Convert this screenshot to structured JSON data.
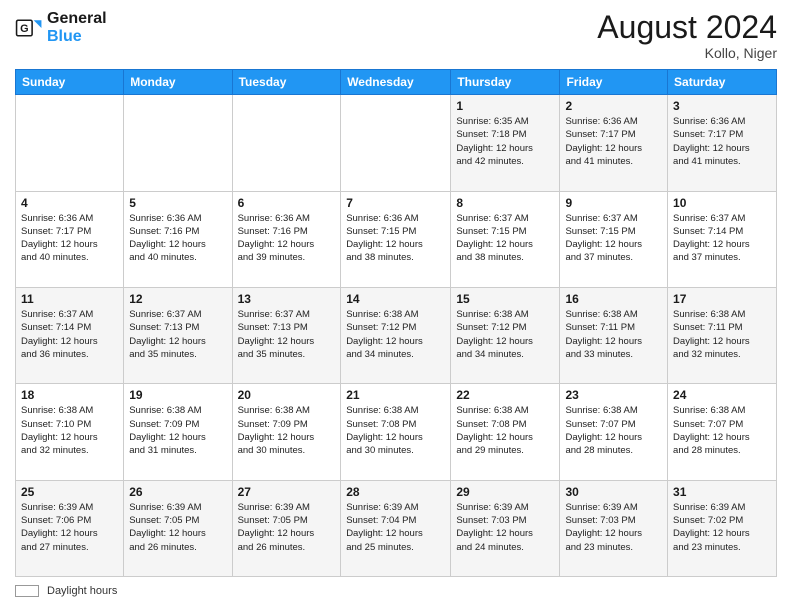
{
  "header": {
    "logo_general": "General",
    "logo_blue": "Blue",
    "month_year": "August 2024",
    "location": "Kollo, Niger"
  },
  "weekdays": [
    "Sunday",
    "Monday",
    "Tuesday",
    "Wednesday",
    "Thursday",
    "Friday",
    "Saturday"
  ],
  "weeks": [
    [
      {
        "day": "",
        "detail": ""
      },
      {
        "day": "",
        "detail": ""
      },
      {
        "day": "",
        "detail": ""
      },
      {
        "day": "",
        "detail": ""
      },
      {
        "day": "1",
        "detail": "Sunrise: 6:35 AM\nSunset: 7:18 PM\nDaylight: 12 hours\nand 42 minutes."
      },
      {
        "day": "2",
        "detail": "Sunrise: 6:36 AM\nSunset: 7:17 PM\nDaylight: 12 hours\nand 41 minutes."
      },
      {
        "day": "3",
        "detail": "Sunrise: 6:36 AM\nSunset: 7:17 PM\nDaylight: 12 hours\nand 41 minutes."
      }
    ],
    [
      {
        "day": "4",
        "detail": "Sunrise: 6:36 AM\nSunset: 7:17 PM\nDaylight: 12 hours\nand 40 minutes."
      },
      {
        "day": "5",
        "detail": "Sunrise: 6:36 AM\nSunset: 7:16 PM\nDaylight: 12 hours\nand 40 minutes."
      },
      {
        "day": "6",
        "detail": "Sunrise: 6:36 AM\nSunset: 7:16 PM\nDaylight: 12 hours\nand 39 minutes."
      },
      {
        "day": "7",
        "detail": "Sunrise: 6:36 AM\nSunset: 7:15 PM\nDaylight: 12 hours\nand 38 minutes."
      },
      {
        "day": "8",
        "detail": "Sunrise: 6:37 AM\nSunset: 7:15 PM\nDaylight: 12 hours\nand 38 minutes."
      },
      {
        "day": "9",
        "detail": "Sunrise: 6:37 AM\nSunset: 7:15 PM\nDaylight: 12 hours\nand 37 minutes."
      },
      {
        "day": "10",
        "detail": "Sunrise: 6:37 AM\nSunset: 7:14 PM\nDaylight: 12 hours\nand 37 minutes."
      }
    ],
    [
      {
        "day": "11",
        "detail": "Sunrise: 6:37 AM\nSunset: 7:14 PM\nDaylight: 12 hours\nand 36 minutes."
      },
      {
        "day": "12",
        "detail": "Sunrise: 6:37 AM\nSunset: 7:13 PM\nDaylight: 12 hours\nand 35 minutes."
      },
      {
        "day": "13",
        "detail": "Sunrise: 6:37 AM\nSunset: 7:13 PM\nDaylight: 12 hours\nand 35 minutes."
      },
      {
        "day": "14",
        "detail": "Sunrise: 6:38 AM\nSunset: 7:12 PM\nDaylight: 12 hours\nand 34 minutes."
      },
      {
        "day": "15",
        "detail": "Sunrise: 6:38 AM\nSunset: 7:12 PM\nDaylight: 12 hours\nand 34 minutes."
      },
      {
        "day": "16",
        "detail": "Sunrise: 6:38 AM\nSunset: 7:11 PM\nDaylight: 12 hours\nand 33 minutes."
      },
      {
        "day": "17",
        "detail": "Sunrise: 6:38 AM\nSunset: 7:11 PM\nDaylight: 12 hours\nand 32 minutes."
      }
    ],
    [
      {
        "day": "18",
        "detail": "Sunrise: 6:38 AM\nSunset: 7:10 PM\nDaylight: 12 hours\nand 32 minutes."
      },
      {
        "day": "19",
        "detail": "Sunrise: 6:38 AM\nSunset: 7:09 PM\nDaylight: 12 hours\nand 31 minutes."
      },
      {
        "day": "20",
        "detail": "Sunrise: 6:38 AM\nSunset: 7:09 PM\nDaylight: 12 hours\nand 30 minutes."
      },
      {
        "day": "21",
        "detail": "Sunrise: 6:38 AM\nSunset: 7:08 PM\nDaylight: 12 hours\nand 30 minutes."
      },
      {
        "day": "22",
        "detail": "Sunrise: 6:38 AM\nSunset: 7:08 PM\nDaylight: 12 hours\nand 29 minutes."
      },
      {
        "day": "23",
        "detail": "Sunrise: 6:38 AM\nSunset: 7:07 PM\nDaylight: 12 hours\nand 28 minutes."
      },
      {
        "day": "24",
        "detail": "Sunrise: 6:38 AM\nSunset: 7:07 PM\nDaylight: 12 hours\nand 28 minutes."
      }
    ],
    [
      {
        "day": "25",
        "detail": "Sunrise: 6:39 AM\nSunset: 7:06 PM\nDaylight: 12 hours\nand 27 minutes."
      },
      {
        "day": "26",
        "detail": "Sunrise: 6:39 AM\nSunset: 7:05 PM\nDaylight: 12 hours\nand 26 minutes."
      },
      {
        "day": "27",
        "detail": "Sunrise: 6:39 AM\nSunset: 7:05 PM\nDaylight: 12 hours\nand 26 minutes."
      },
      {
        "day": "28",
        "detail": "Sunrise: 6:39 AM\nSunset: 7:04 PM\nDaylight: 12 hours\nand 25 minutes."
      },
      {
        "day": "29",
        "detail": "Sunrise: 6:39 AM\nSunset: 7:03 PM\nDaylight: 12 hours\nand 24 minutes."
      },
      {
        "day": "30",
        "detail": "Sunrise: 6:39 AM\nSunset: 7:03 PM\nDaylight: 12 hours\nand 23 minutes."
      },
      {
        "day": "31",
        "detail": "Sunrise: 6:39 AM\nSunset: 7:02 PM\nDaylight: 12 hours\nand 23 minutes."
      }
    ]
  ],
  "footer": {
    "legend_label": "Daylight hours"
  }
}
